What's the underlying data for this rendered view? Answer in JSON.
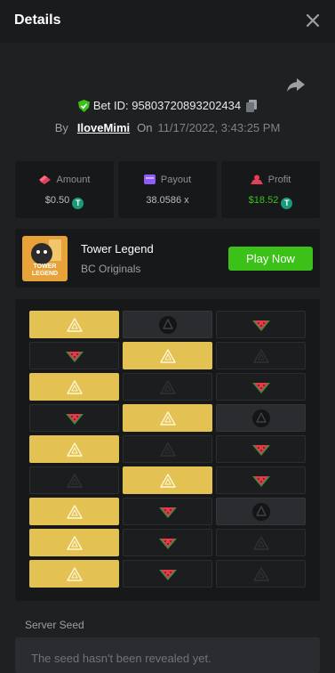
{
  "header": {
    "title": "Details"
  },
  "bet": {
    "id_text": "Bet ID: 95803720893202434",
    "by_label": "By",
    "user": "IloveMimi",
    "on_label": "On",
    "date": "11/17/2022, 3:43:25 PM"
  },
  "stats": {
    "amount": {
      "label": "Amount",
      "value": "$0.50"
    },
    "payout": {
      "label": "Payout",
      "value": "38.0586 x"
    },
    "profit": {
      "label": "Profit",
      "value": "$18.52"
    }
  },
  "token_symbol": "T",
  "game": {
    "thumb_text": "TOWER LEGEND",
    "name": "Tower Legend",
    "provider": "BC Originals",
    "play_label": "Play Now"
  },
  "board": {
    "columns": 3,
    "rows": [
      [
        "gold-gem",
        "dark-gem",
        "empty-melon"
      ],
      [
        "empty-melon",
        "gold-gem",
        "empty-dimgem"
      ],
      [
        "gold-gem",
        "empty-dimgem",
        "empty-melon"
      ],
      [
        "empty-melon",
        "gold-gem",
        "dim-gem"
      ],
      [
        "gold-gem",
        "empty-dimgem",
        "empty-melon"
      ],
      [
        "empty-dimgem",
        "gold-gem",
        "empty-melon"
      ],
      [
        "gold-gem",
        "empty-melon",
        "dim-gem"
      ],
      [
        "gold-gem",
        "empty-melon",
        "empty-dimgem"
      ],
      [
        "gold-gem",
        "empty-melon",
        "empty-dimgem"
      ]
    ]
  },
  "seed": {
    "label": "Server Seed",
    "placeholder": "The seed hasn't been revealed yet."
  },
  "colors": {
    "accent_green": "#3bc117",
    "gold": "#e3c152",
    "profit_green": "#3bc117"
  }
}
